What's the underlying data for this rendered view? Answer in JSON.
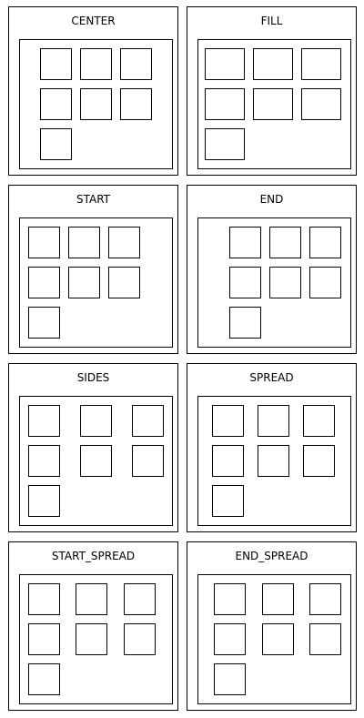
{
  "panels": [
    {
      "title": "CENTER",
      "item_count": 7
    },
    {
      "title": "FILL",
      "item_count": 7
    },
    {
      "title": "START",
      "item_count": 7
    },
    {
      "title": "END",
      "item_count": 7
    },
    {
      "title": "SIDES",
      "item_count": 7
    },
    {
      "title": "SPREAD",
      "item_count": 7
    },
    {
      "title": "START_SPREAD",
      "item_count": 7
    },
    {
      "title": "END_SPREAD",
      "item_count": 7
    }
  ]
}
